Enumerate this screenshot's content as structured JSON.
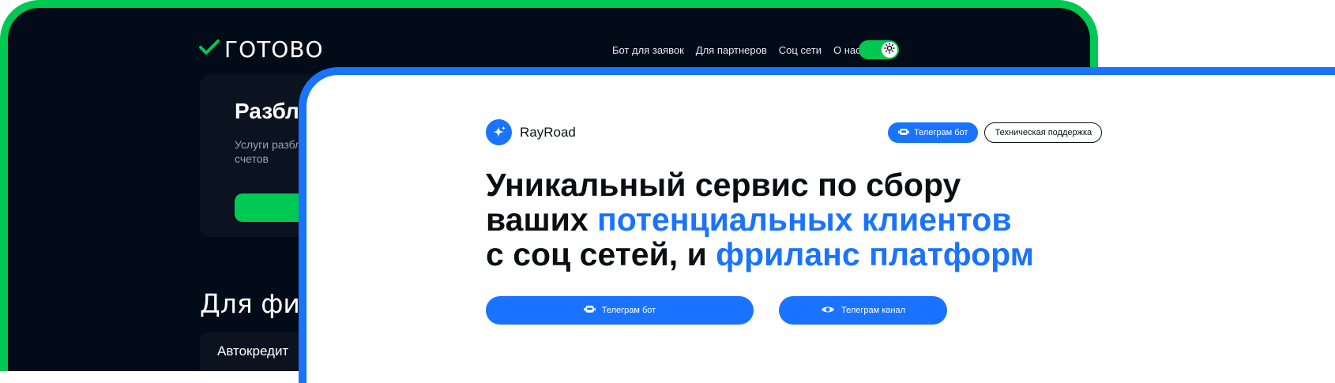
{
  "dark_site": {
    "logo_text": "ГОТОВО",
    "nav": [
      "Бот для заявок",
      "Для партнеров",
      "Соц сети",
      "О нас"
    ],
    "hero_title": "Разблокировка",
    "hero_subtitle": "Услуги разблокировки физ/юр счетов",
    "section_title": "Для физ лиц",
    "row_label": "Автокредит",
    "colors": {
      "accent": "#00c853",
      "background": "#020b18"
    }
  },
  "light_site": {
    "logo_text": "RayRoad",
    "top_buttons": {
      "telegram_bot": "Телеграм бот",
      "support": "Техническая поддержка"
    },
    "heading": {
      "line1": "Уникальный сервис по сбору",
      "line2_plain": "ваших ",
      "line2_accent": "потенциальных клиентов",
      "line3_plain": "с соц сетей, и ",
      "line3_accent": "фриланс платформ"
    },
    "cta": {
      "telegram_bot": "Телеграм бот",
      "telegram_channel": "Телеграм канал"
    },
    "colors": {
      "accent": "#1a73ff"
    }
  }
}
